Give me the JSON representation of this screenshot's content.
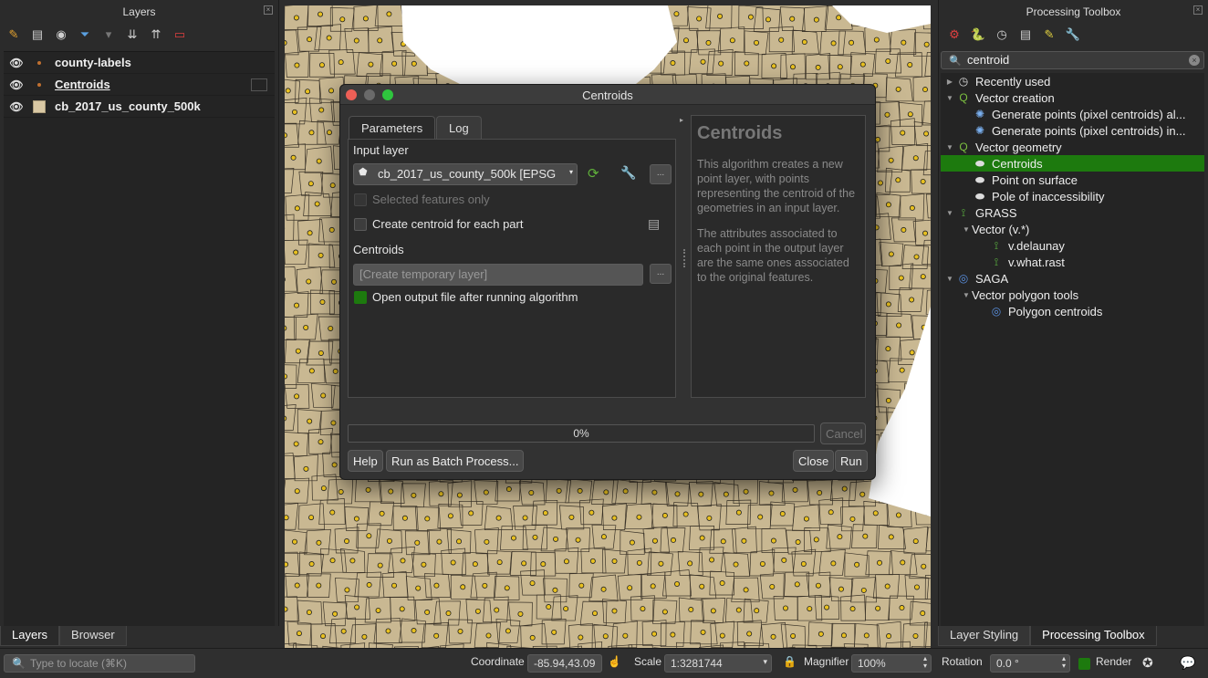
{
  "layers_panel": {
    "title": "Layers",
    "layers": [
      {
        "name": "county-labels",
        "underlined": false
      },
      {
        "name": "Centroids",
        "underlined": true
      },
      {
        "name": "cb_2017_us_county_500k",
        "underlined": false
      }
    ],
    "tabs": [
      "Layers",
      "Browser"
    ]
  },
  "toolbox_panel": {
    "title": "Processing Toolbox",
    "search_value": "centroid",
    "tree": [
      {
        "label": "Recently used",
        "indent": 0,
        "icon": "clock-icon",
        "arrow": "right"
      },
      {
        "label": "Vector creation",
        "indent": 0,
        "icon": "qgis-icon",
        "arrow": "down"
      },
      {
        "label": "Generate points (pixel centroids) al...",
        "indent": 1,
        "icon": "gear-icon",
        "arrow": ""
      },
      {
        "label": "Generate points (pixel centroids) in...",
        "indent": 1,
        "icon": "gear-icon",
        "arrow": ""
      },
      {
        "label": "Vector geometry",
        "indent": 0,
        "icon": "qgis-icon",
        "arrow": "down"
      },
      {
        "label": "Centroids",
        "indent": 1,
        "icon": "centroid-icon",
        "arrow": "",
        "selected": true
      },
      {
        "label": "Point on surface",
        "indent": 1,
        "icon": "centroid-icon",
        "arrow": ""
      },
      {
        "label": "Pole of inaccessibility",
        "indent": 1,
        "icon": "centroid-icon",
        "arrow": ""
      },
      {
        "label": "GRASS",
        "indent": 0,
        "icon": "grass-icon",
        "arrow": "down"
      },
      {
        "label": "Vector (v.*)",
        "indent": 1,
        "icon": "",
        "arrow": "down"
      },
      {
        "label": "v.delaunay",
        "indent": 2,
        "icon": "grass-icon",
        "arrow": ""
      },
      {
        "label": "v.what.rast",
        "indent": 2,
        "icon": "grass-icon",
        "arrow": ""
      },
      {
        "label": "SAGA",
        "indent": 0,
        "icon": "saga-icon",
        "arrow": "down"
      },
      {
        "label": "Vector polygon tools",
        "indent": 1,
        "icon": "",
        "arrow": "down"
      },
      {
        "label": "Polygon centroids",
        "indent": 2,
        "icon": "saga-icon",
        "arrow": ""
      }
    ],
    "tabs": [
      "Layer Styling",
      "Processing Toolbox"
    ]
  },
  "dialog": {
    "title": "Centroids",
    "tabs": [
      "Parameters",
      "Log"
    ],
    "input_layer_label": "Input layer",
    "input_layer_value": "cb_2017_us_county_500k [EPSG",
    "selected_only_label": "Selected features only",
    "each_part_label": "Create centroid for each part",
    "output_label": "Centroids",
    "output_placeholder": "[Create temporary layer]",
    "open_output_label": "Open output file after running algorithm",
    "help_title": "Centroids",
    "help_p1": "This algorithm creates a new point layer, with points representing the centroid of the geometries in an input layer.",
    "help_p2": "The attributes associated to each point in the output layer are the same ones associated to the original features.",
    "progress_text": "0%",
    "progress_value": 0,
    "buttons": {
      "cancel": "Cancel",
      "help": "Help",
      "batch": "Run as Batch Process...",
      "close": "Close",
      "run": "Run"
    }
  },
  "statusbar": {
    "locate_placeholder": "Type to locate (⌘K)",
    "coordinate_label": "Coordinate",
    "coordinate_value": "-85.94,43.09",
    "scale_label": "Scale",
    "scale_value": "1:3281744",
    "magnifier_label": "Magnifier",
    "magnifier_value": "100%",
    "rotation_label": "Rotation",
    "rotation_value": "0.0 °",
    "render_label": "Render"
  },
  "colors": {
    "accent_green": "#1d7a0e",
    "county_fill": "#c9b892",
    "centroid_fill": "#e8c020"
  }
}
